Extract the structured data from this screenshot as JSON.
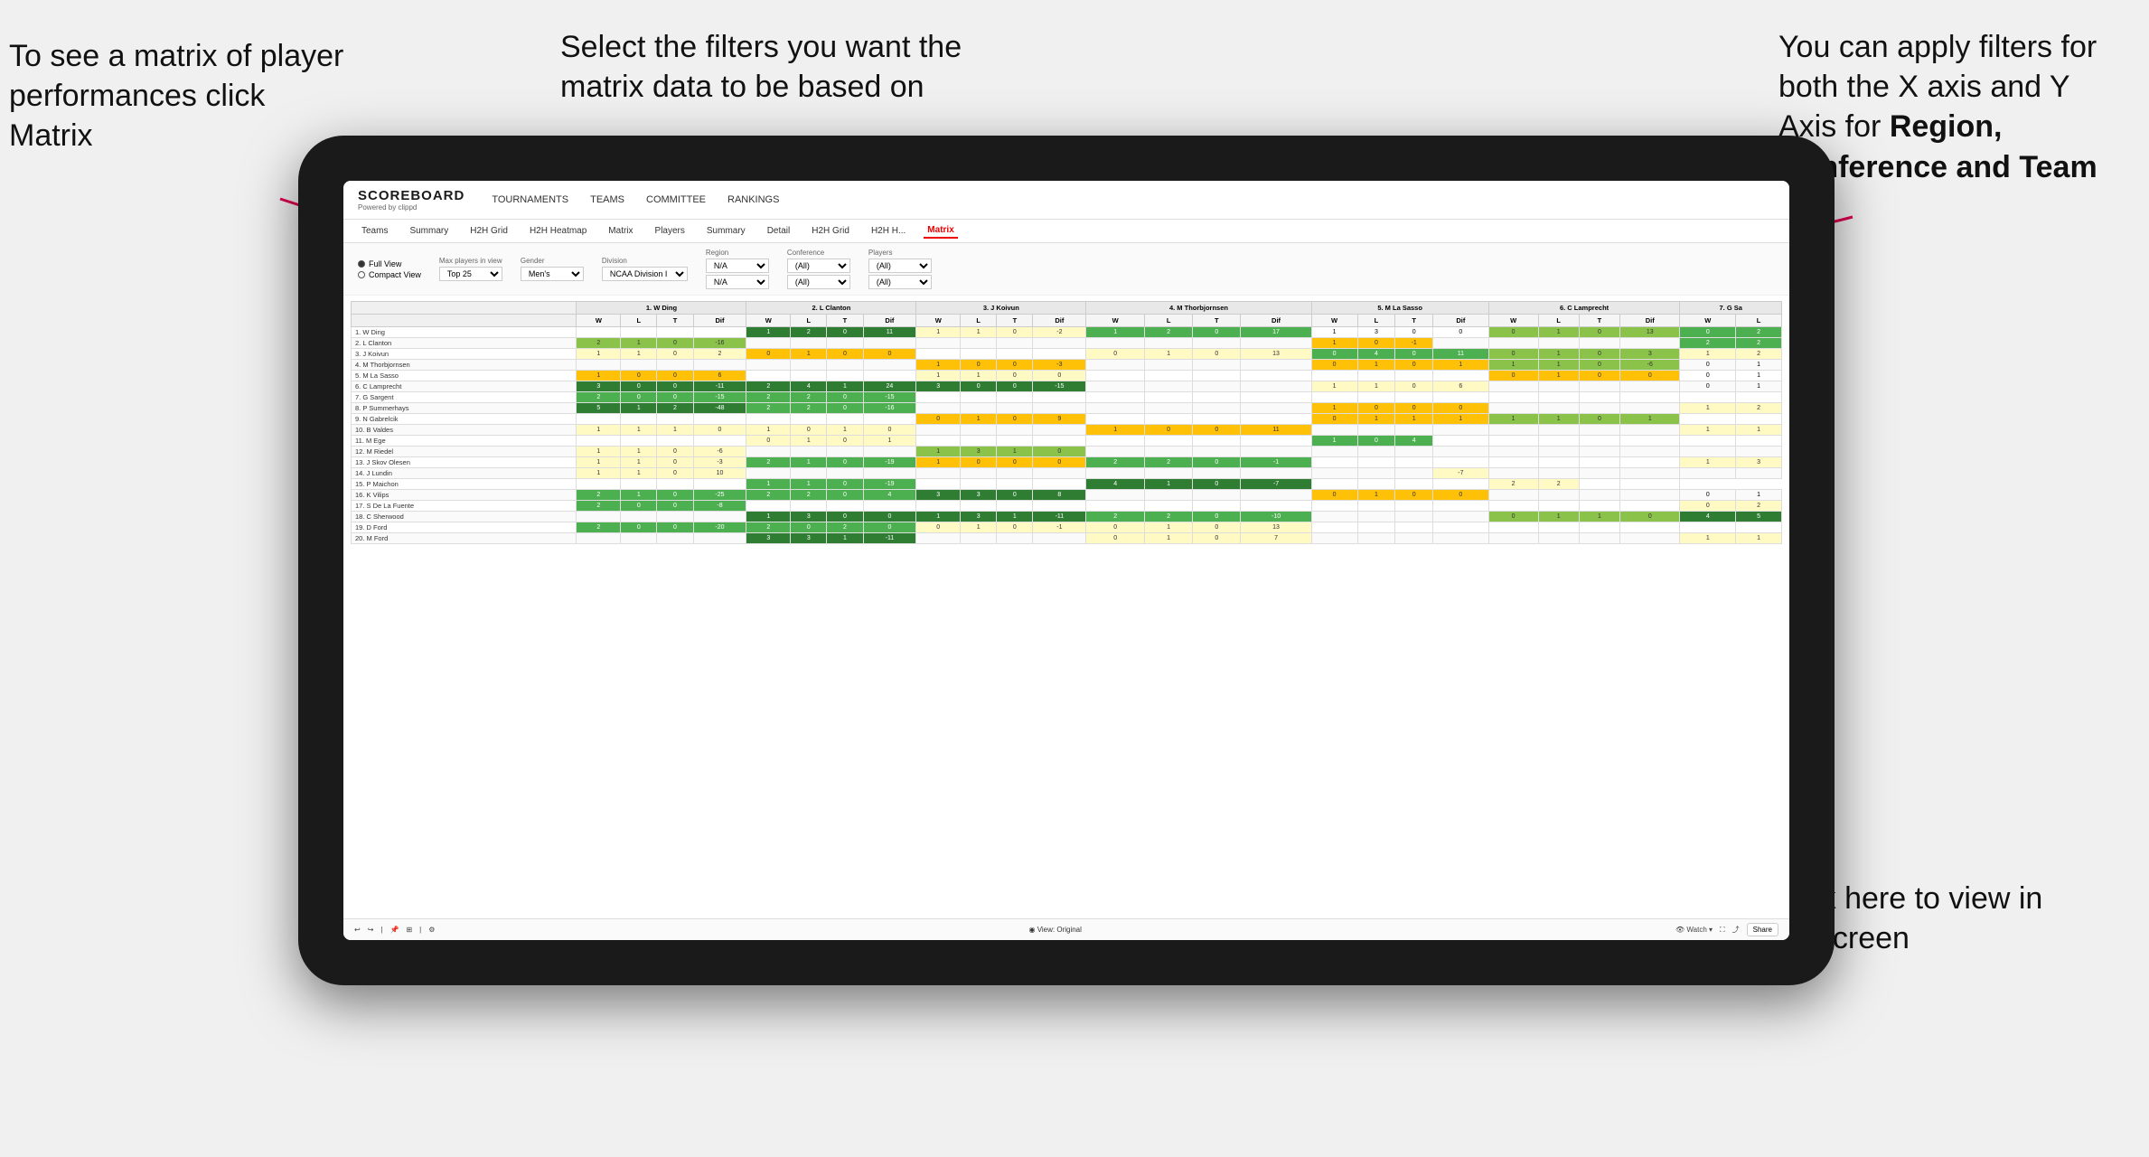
{
  "annotations": {
    "matrix_text": "To see a matrix of player performances click Matrix",
    "matrix_bold": "Matrix",
    "filters_text": "Select the filters you want the matrix data to be based on",
    "axes_text": "You  can apply filters for both the X axis and Y Axis for Region, Conference and Team",
    "axes_bold": "Region, Conference and Team",
    "fullscreen_text": "Click here to view in full screen"
  },
  "nav": {
    "logo": "SCOREBOARD",
    "logo_sub": "Powered by clippd",
    "items": [
      "TOURNAMENTS",
      "TEAMS",
      "COMMITTEE",
      "RANKINGS"
    ]
  },
  "sub_nav": {
    "items": [
      "Teams",
      "Summary",
      "H2H Grid",
      "H2H Heatmap",
      "Matrix",
      "Players",
      "Summary",
      "Detail",
      "H2H Grid",
      "H2H H...",
      "Matrix"
    ],
    "active": "Matrix"
  },
  "filters": {
    "view_full": "Full View",
    "view_compact": "Compact View",
    "max_players_label": "Max players in view",
    "max_players_value": "Top 25",
    "gender_label": "Gender",
    "gender_value": "Men's",
    "division_label": "Division",
    "division_value": "NCAA Division I",
    "region_label": "Region",
    "region_value": "N/A",
    "region_value2": "N/A",
    "conference_label": "Conference",
    "conference_value": "(All)",
    "conference_value2": "(All)",
    "players_label": "Players",
    "players_value": "(All)",
    "players_value2": "(All)"
  },
  "matrix": {
    "col_headers": [
      "1. W Ding",
      "2. L Clanton",
      "3. J Koivun",
      "4. M Thorbjornsen",
      "5. M La Sasso",
      "6. C Lamprecht",
      "7. G Sa"
    ],
    "sub_headers": [
      "W",
      "L",
      "T",
      "Dif"
    ],
    "rows": [
      {
        "name": "1. W Ding",
        "cells": [
          [
            "",
            "",
            "",
            ""
          ],
          [
            "1",
            "2",
            "0",
            "11"
          ],
          [
            "1",
            "1",
            "0",
            "-2"
          ],
          [
            "1",
            "2",
            "0",
            "17"
          ],
          [
            "1",
            "3",
            "0",
            "0"
          ],
          [
            "0",
            "1",
            "0",
            "13"
          ],
          [
            "0",
            "2"
          ]
        ]
      },
      {
        "name": "2. L Clanton",
        "cells": [
          [
            "2",
            "1",
            "0",
            "-16"
          ],
          [
            "",
            "",
            "",
            ""
          ],
          [
            "",
            "",
            "",
            ""
          ],
          [
            "",
            "",
            "",
            ""
          ],
          [
            "1",
            "0",
            "-1"
          ],
          [
            "",
            "",
            "",
            ""
          ],
          [
            "2",
            "2"
          ]
        ]
      },
      {
        "name": "3. J Koivun",
        "cells": [
          [
            "1",
            "1",
            "0",
            "2"
          ],
          [
            "0",
            "1",
            "0",
            "0"
          ],
          [
            "",
            "",
            "",
            ""
          ],
          [
            "0",
            "1",
            "0",
            "13"
          ],
          [
            "0",
            "4",
            "0",
            "11"
          ],
          [
            "0",
            "1",
            "0",
            "3"
          ],
          [
            "1",
            "2"
          ]
        ]
      },
      {
        "name": "4. M Thorbjornsen",
        "cells": [
          [
            "",
            "",
            "",
            ""
          ],
          [
            "",
            "",
            "",
            ""
          ],
          [
            "1",
            "0",
            "0",
            "-3"
          ],
          [
            "",
            "",
            "",
            ""
          ],
          [
            "0",
            "1",
            "0",
            "1"
          ],
          [
            "1",
            "1",
            "0",
            "-6"
          ],
          [
            "0",
            "1"
          ]
        ]
      },
      {
        "name": "5. M La Sasso",
        "cells": [
          [
            "1",
            "0",
            "0",
            "6"
          ],
          [
            "",
            "",
            "",
            ""
          ],
          [
            "1",
            "1",
            "0",
            "0"
          ],
          [
            "",
            "",
            "",
            ""
          ],
          [
            "",
            "",
            "",
            ""
          ],
          [
            "0",
            "1",
            "0",
            "0"
          ],
          [
            "0",
            "1"
          ]
        ]
      },
      {
        "name": "6. C Lamprecht",
        "cells": [
          [
            "3",
            "0",
            "0",
            "-11"
          ],
          [
            "2",
            "4",
            "1",
            "24"
          ],
          [
            "3",
            "0",
            "0",
            "-15"
          ],
          [
            "",
            "",
            "",
            ""
          ],
          [
            "1",
            "1",
            "0",
            "6"
          ],
          [
            "",
            "",
            "",
            ""
          ],
          [
            "0",
            "1"
          ]
        ]
      },
      {
        "name": "7. G Sargent",
        "cells": [
          [
            "2",
            "0",
            "0",
            "-15"
          ],
          [
            "2",
            "2",
            "0",
            "-15"
          ],
          [
            "",
            "",
            "",
            ""
          ],
          [
            "",
            "",
            "",
            ""
          ],
          [
            "",
            "",
            "",
            ""
          ],
          [
            "",
            "",
            "",
            ""
          ],
          [
            ""
          ]
        ]
      },
      {
        "name": "8. P Summerhays",
        "cells": [
          [
            "5",
            "1",
            "2",
            "-48"
          ],
          [
            "2",
            "2",
            "0",
            "-16"
          ],
          [
            "",
            "",
            "",
            ""
          ],
          [
            "",
            "",
            "",
            ""
          ],
          [
            "1",
            "0",
            "0",
            "0"
          ],
          [
            "",
            "",
            "",
            ""
          ],
          [
            "1",
            "2"
          ]
        ]
      },
      {
        "name": "9. N Gabrelcik",
        "cells": [
          [
            "",
            "",
            "",
            ""
          ],
          [
            "",
            "",
            "",
            ""
          ],
          [
            "0",
            "1",
            "0",
            "9"
          ],
          [
            "",
            "",
            "",
            ""
          ],
          [
            "0",
            "1",
            "1",
            "1"
          ],
          [
            "1",
            "1",
            "0",
            "1"
          ],
          [
            ""
          ]
        ]
      },
      {
        "name": "10. B Valdes",
        "cells": [
          [
            "1",
            "1",
            "1",
            "0"
          ],
          [
            "1",
            "0",
            "1",
            "0"
          ],
          [
            "",
            "",
            "",
            ""
          ],
          [
            "1",
            "0",
            "0",
            "11"
          ],
          [
            "",
            "",
            "",
            ""
          ],
          [
            "",
            "",
            "",
            ""
          ],
          [
            "1",
            "1"
          ]
        ]
      },
      {
        "name": "11. M Ege",
        "cells": [
          [
            "",
            "",
            "",
            ""
          ],
          [
            "0",
            "1",
            "0",
            "1"
          ],
          [
            "",
            "",
            "",
            ""
          ],
          [
            "",
            "",
            "",
            ""
          ],
          [
            "1",
            "0",
            "4"
          ],
          [
            "",
            "",
            "",
            ""
          ],
          [
            ""
          ]
        ]
      },
      {
        "name": "12. M Riedel",
        "cells": [
          [
            "1",
            "1",
            "0",
            "-6"
          ],
          [
            "",
            "",
            "",
            ""
          ],
          [
            "1",
            "3",
            "1",
            "0"
          ],
          [
            "",
            "",
            "",
            ""
          ],
          [
            "",
            "",
            "",
            ""
          ],
          [
            "",
            "",
            "",
            ""
          ],
          [
            ""
          ]
        ]
      },
      {
        "name": "13. J Skov Olesen",
        "cells": [
          [
            "1",
            "1",
            "0",
            "-3"
          ],
          [
            "2",
            "1",
            "0",
            "-19"
          ],
          [
            "1",
            "0",
            "0",
            "0"
          ],
          [
            "2",
            "2",
            "0",
            "-1"
          ],
          [
            "",
            "",
            "",
            ""
          ],
          [
            "",
            "",
            "",
            ""
          ],
          [
            "1",
            "3"
          ]
        ]
      },
      {
        "name": "14. J Lundin",
        "cells": [
          [
            "1",
            "1",
            "0",
            "10"
          ],
          [
            "",
            "",
            "",
            ""
          ],
          [
            "",
            "",
            "",
            ""
          ],
          [
            "",
            "",
            "",
            ""
          ],
          [
            "",
            "",
            "",
            "-7"
          ],
          [
            "",
            "",
            "",
            ""
          ],
          [
            ""
          ]
        ]
      },
      {
        "name": "15. P Maichon",
        "cells": [
          [
            "",
            "",
            "",
            ""
          ],
          [
            "1",
            "1",
            "0",
            "-19"
          ],
          [
            "",
            "",
            "",
            ""
          ],
          [
            "4",
            "1",
            "0",
            "-7"
          ],
          [
            "",
            "",
            "",
            ""
          ],
          [
            "2",
            "2"
          ]
        ]
      },
      {
        "name": "16. K Vilips",
        "cells": [
          [
            "2",
            "1",
            "0",
            "-25"
          ],
          [
            "2",
            "2",
            "0",
            "4"
          ],
          [
            "3",
            "3",
            "0",
            "8"
          ],
          [
            "",
            "",
            "",
            ""
          ],
          [
            "0",
            "1",
            "0",
            "0"
          ],
          [
            "",
            "",
            "",
            ""
          ],
          [
            "0",
            "1"
          ]
        ]
      },
      {
        "name": "17. S De La Fuente",
        "cells": [
          [
            "2",
            "0",
            "0",
            "-8"
          ],
          [
            "",
            "",
            "",
            ""
          ],
          [
            "",
            "",
            "",
            ""
          ],
          [
            "",
            "",
            "",
            ""
          ],
          [
            "",
            "",
            "",
            ""
          ],
          [
            "",
            "",
            "",
            ""
          ],
          [
            "0",
            "2"
          ]
        ]
      },
      {
        "name": "18. C Sherwood",
        "cells": [
          [
            "",
            "",
            "",
            ""
          ],
          [
            "1",
            "3",
            "0",
            "0"
          ],
          [
            "1",
            "3",
            "1",
            "-11"
          ],
          [
            "2",
            "2",
            "0",
            "-10"
          ],
          [
            "",
            "",
            "",
            ""
          ],
          [
            "0",
            "1",
            "1",
            "0"
          ],
          [
            "4",
            "5"
          ]
        ]
      },
      {
        "name": "19. D Ford",
        "cells": [
          [
            "2",
            "0",
            "0",
            "-20"
          ],
          [
            "2",
            "0",
            "2",
            "0"
          ],
          [
            "0",
            "1",
            "0",
            "-1"
          ],
          [
            "0",
            "1",
            "0",
            "13"
          ],
          [
            "",
            "",
            "",
            ""
          ],
          [
            "",
            "",
            "",
            ""
          ],
          [
            ""
          ]
        ]
      },
      {
        "name": "20. M Ford",
        "cells": [
          [
            "",
            "",
            "",
            ""
          ],
          [
            "3",
            "3",
            "1",
            "-11"
          ],
          [
            "",
            "",
            "",
            ""
          ],
          [
            "0",
            "1",
            "0",
            "7"
          ],
          [
            "",
            "",
            "",
            ""
          ],
          [
            "",
            "",
            "",
            ""
          ],
          [
            "1",
            "1"
          ]
        ]
      }
    ]
  },
  "toolbar": {
    "view_label": "View: Original",
    "watch_label": "Watch",
    "share_label": "Share"
  }
}
